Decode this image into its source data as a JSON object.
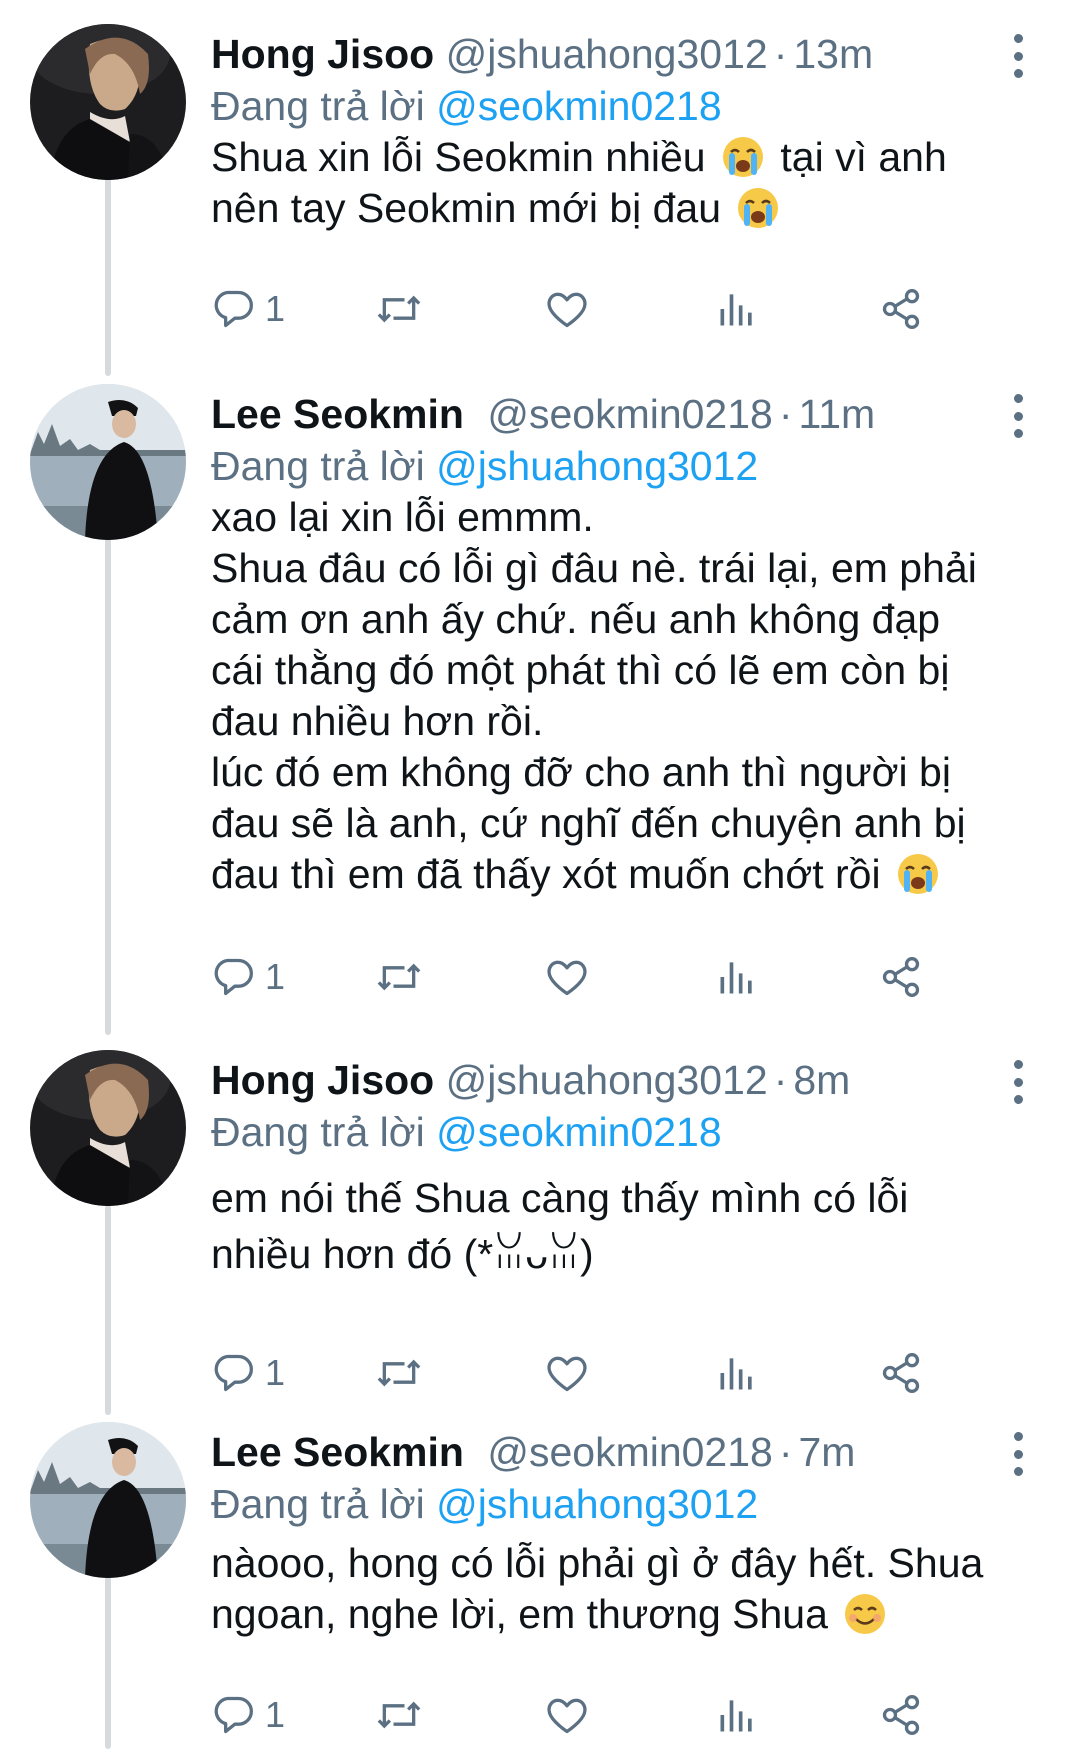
{
  "colors": {
    "accent": "#1da1f2",
    "muted": "#5b7083",
    "text": "#0f1419",
    "thread": "#d6dadd"
  },
  "tweets": [
    {
      "name": "Hong Jisoo",
      "handle": "@jshuahong3012",
      "sep": "·",
      "time": "13m",
      "reply_prefix": "Đang trả lời",
      "reply_to": "@seokmin0218",
      "lines": [
        {
          "text": "Shua xin lỗi Seokmin nhiều",
          "emoji": "loudly-crying-face",
          "tail": "tại vì anh"
        },
        {
          "text": "nên tay Seokmin mới bị đau",
          "emoji": "loudly-crying-face",
          "tail": ""
        }
      ],
      "reply_count": "1",
      "avatar": "avatar-jisoo"
    },
    {
      "name": "Lee Seokmin",
      "handle": "@seokmin0218",
      "sep": "·",
      "time": "11m",
      "reply_prefix": "Đang trả lời",
      "reply_to": "@jshuahong3012",
      "lines": [
        {
          "text": "xao lại xin lỗi emmm.",
          "emoji": "",
          "tail": ""
        },
        {
          "text": "Shua đâu có lỗi gì đâu nè. trái lại, em phải",
          "emoji": "",
          "tail": ""
        },
        {
          "text": "cảm ơn anh ấy chứ. nếu anh không đạp",
          "emoji": "",
          "tail": ""
        },
        {
          "text": "cái thằng đó một phát thì có lẽ em còn bị",
          "emoji": "",
          "tail": ""
        },
        {
          "text": "đau nhiều hơn rồi.",
          "emoji": "",
          "tail": ""
        },
        {
          "text": "lúc đó em không đỡ cho anh thì người bị",
          "emoji": "",
          "tail": ""
        },
        {
          "text": "đau sẽ là anh, cứ nghĩ đến chuyện anh bị",
          "emoji": "",
          "tail": ""
        },
        {
          "text": "đau thì em đã thấy xót muốn chớt rồi",
          "emoji": "loudly-crying-face",
          "tail": ""
        }
      ],
      "reply_count": "1",
      "avatar": "avatar-seokmin"
    },
    {
      "name": "Hong Jisoo",
      "handle": "@jshuahong3012",
      "sep": "·",
      "time": "8m",
      "reply_prefix": "Đang trả lời",
      "reply_to": "@seokmin0218",
      "lines": [
        {
          "text": "em nói thế Shua càng thấy mình có lỗi",
          "emoji": "",
          "tail": ""
        },
        {
          "text": "nhiều hơn đó (*ꈍᴗꈍ)",
          "emoji": "",
          "tail": ""
        }
      ],
      "reply_count": "1",
      "avatar": "avatar-jisoo"
    },
    {
      "name": "Lee Seokmin",
      "handle": "@seokmin0218",
      "sep": "·",
      "time": "7m",
      "reply_prefix": "Đang trả lời",
      "reply_to": "@jshuahong3012",
      "lines": [
        {
          "text": "nàooo, hong có lỗi phải gì ở đây hết. Shua",
          "emoji": "",
          "tail": ""
        },
        {
          "text": "ngoan, nghe lời, em thương Shua",
          "emoji": "smiling-face",
          "tail": ""
        }
      ],
      "reply_count": "1",
      "avatar": "avatar-seokmin"
    }
  ]
}
